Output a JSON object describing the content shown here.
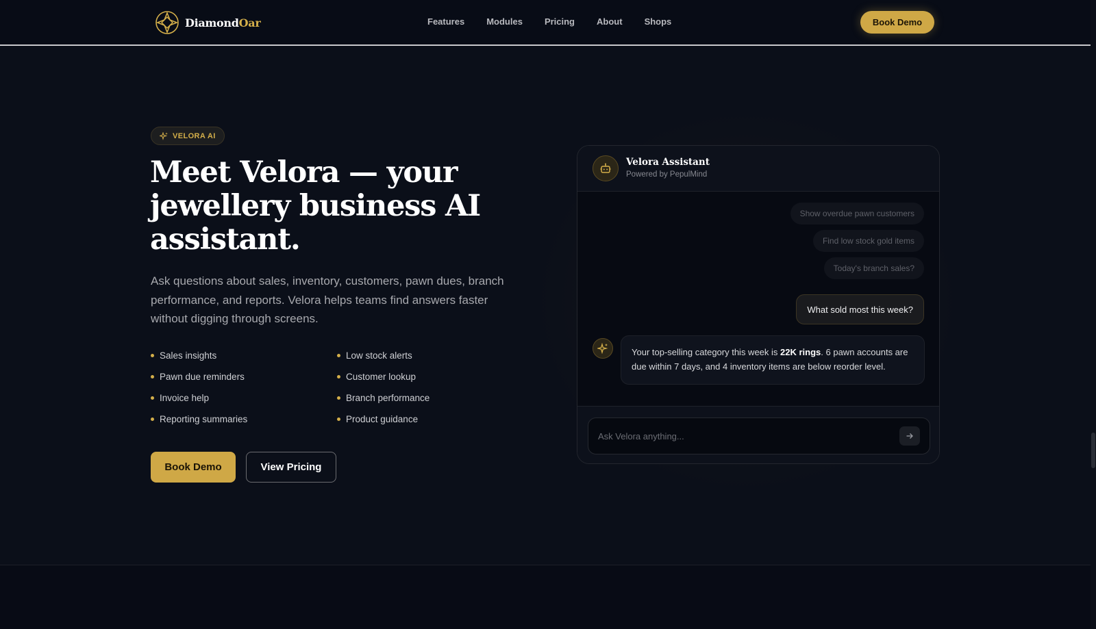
{
  "header": {
    "logo": {
      "word1": "Diamond",
      "word2": "Oar",
      "icon": "diamond-compass-icon"
    },
    "nav": [
      "Features",
      "Modules",
      "Pricing",
      "About",
      "Shops"
    ],
    "cta_label": "Book Demo"
  },
  "hero": {
    "badge": "VELORA AI",
    "badge_icon": "sparkle-icon",
    "title": "Meet Velora — your jewellery business AI assistant.",
    "subtitle": "Ask questions about sales, inventory, customers, pawn dues, branch performance, and reports. Velora helps teams find answers faster without digging through screens.",
    "features": [
      "Sales insights",
      "Low stock alerts",
      "Pawn due reminders",
      "Customer lookup",
      "Invoice help",
      "Branch performance",
      "Reporting summaries",
      "Product guidance"
    ],
    "primary_button": "Book Demo",
    "secondary_button": "View Pricing"
  },
  "chat": {
    "title": "Velora Assistant",
    "subtitle": "Powered by PepulMind",
    "avatar_icon": "robot-icon",
    "suggestions": [
      "Show overdue pawn customers",
      "Find low stock gold items",
      "Today's branch sales?"
    ],
    "user_message": "What sold most this week?",
    "ai_message": {
      "prefix": "Your top-selling category this week is ",
      "highlight": "22K rings",
      "suffix": ". 6 pawn accounts are due within 7 days, and 4 inventory items are below reorder level."
    },
    "input_placeholder": "Ask Velora anything...",
    "send_icon": "arrow-right-icon"
  },
  "colors": {
    "background": "#0b0f19",
    "accent_gold": "#cfa846",
    "text_primary": "#ffffff",
    "text_muted": "#a8a9ae"
  }
}
